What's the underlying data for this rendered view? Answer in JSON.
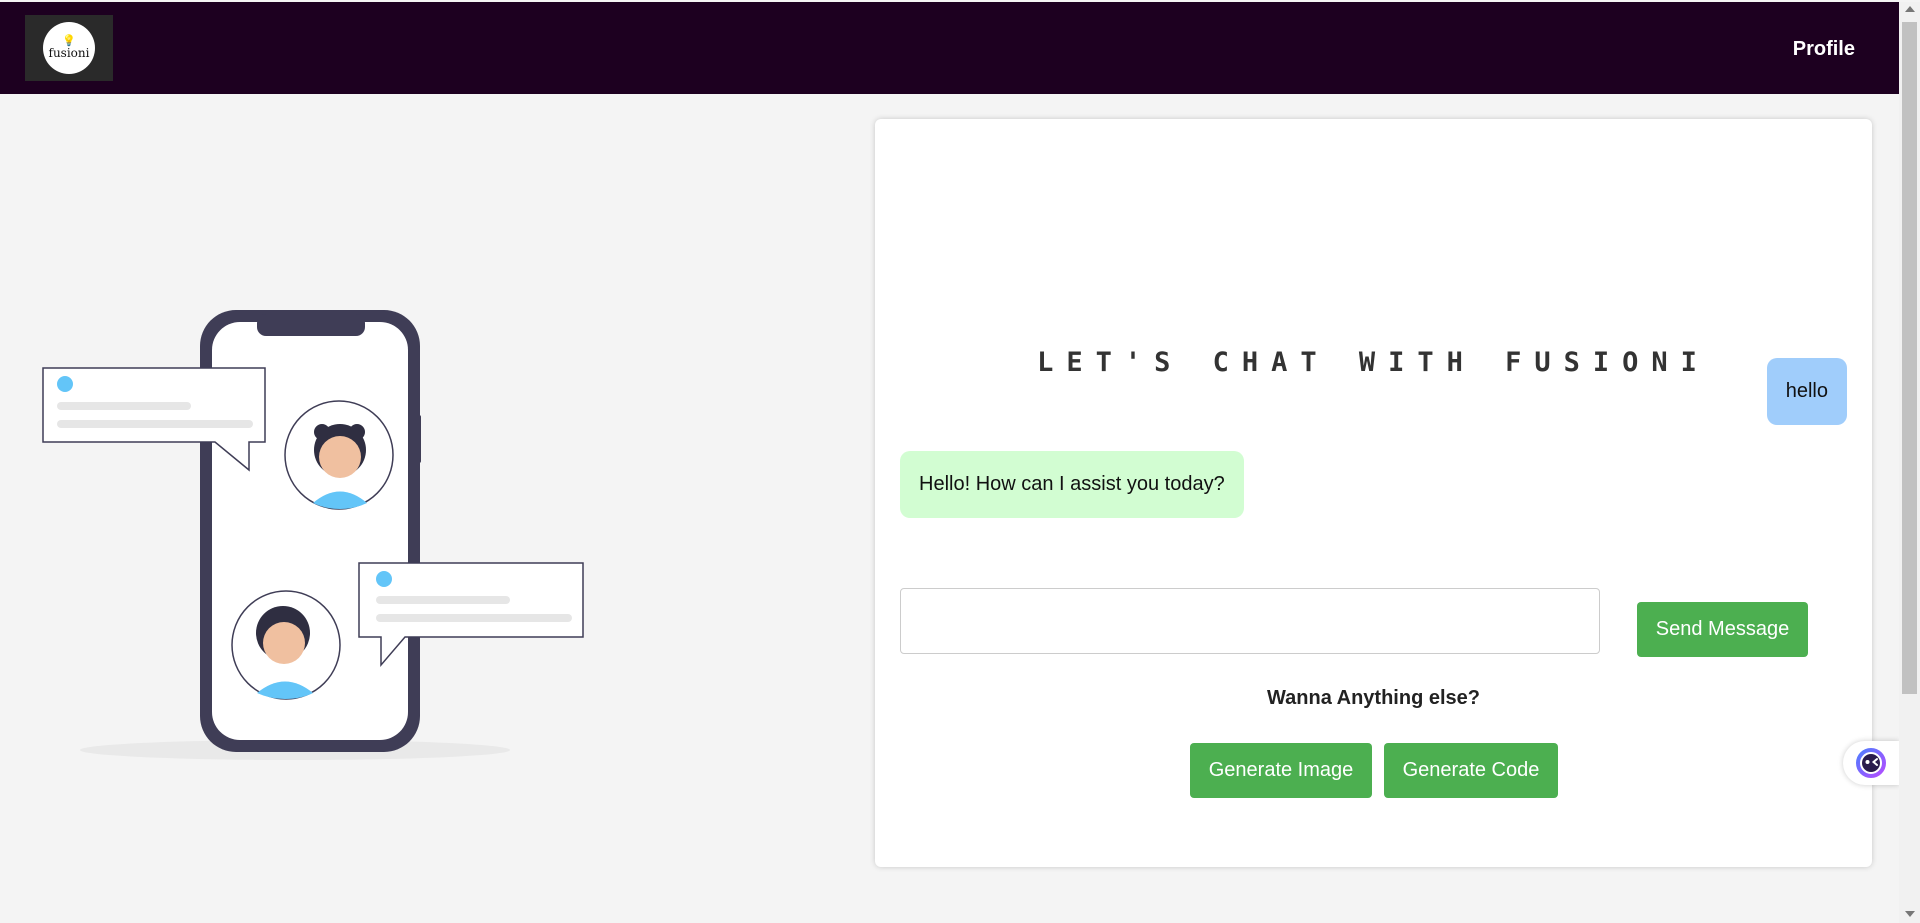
{
  "navbar": {
    "logo_text": "fusioni",
    "profile_label": "Profile"
  },
  "chat": {
    "title": "LET'S CHAT WITH FUSIONI",
    "messages": [
      {
        "sender": "user",
        "text": "hello"
      },
      {
        "sender": "bot",
        "text": "Hello! How can I assist you today?"
      }
    ],
    "input_value": "",
    "send_label": "Send Message",
    "more_prompt": "Wanna Anything else?",
    "generate_image_label": "Generate Image",
    "generate_code_label": "Generate Code"
  },
  "icons": {
    "assistant": "assistant-face-icon",
    "logo": "lightbulb-icon"
  },
  "colors": {
    "navbar_bg": "#1d0020",
    "button_green": "#4caf50",
    "user_bubble": "#a0cdfb",
    "bot_bubble": "#d2fdd2",
    "illustration_accent": "#63c5f8"
  }
}
